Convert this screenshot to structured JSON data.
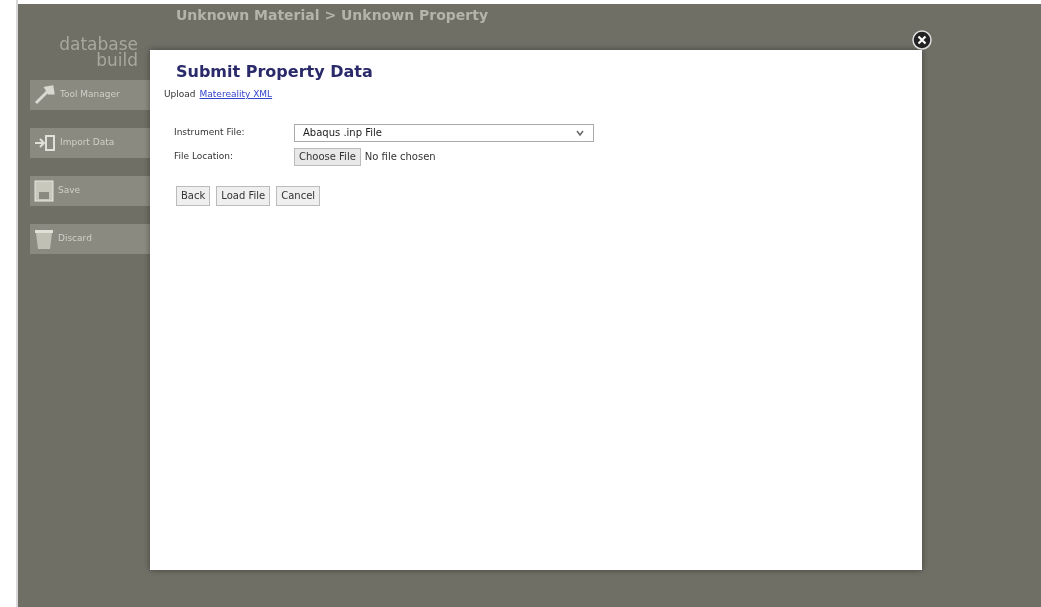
{
  "header": {
    "breadcrumb": "Unknown Material > Unknown Property"
  },
  "logo": {
    "line_1": "database",
    "line_2": "build"
  },
  "sidebar": {
    "items": [
      {
        "label": "Tool Manager",
        "kind": "tool"
      },
      {
        "label": "Import Data",
        "kind": "import"
      },
      {
        "label": "Save",
        "kind": "save"
      },
      {
        "label": "Discard",
        "kind": "discard"
      }
    ]
  },
  "dialog": {
    "title": "Submit Property Data",
    "upload_prefix": "Upload",
    "upload_link": "Matereality XML",
    "instrument_label": "Instrument File:",
    "instrument_value": "Abaqus .inp File",
    "location_label": "File Location:",
    "choose_button": "Choose File",
    "no_file": "No file chosen",
    "buttons": [
      "Back",
      "Load File",
      "Cancel"
    ]
  }
}
